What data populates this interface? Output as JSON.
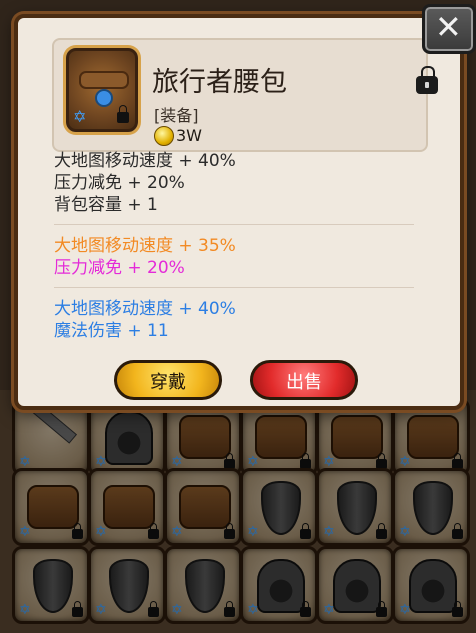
{
  "item": {
    "name": "旅行者腰包",
    "type": "[装备]",
    "price": "3W"
  },
  "stats": {
    "base": [
      "大地图移动速度 + 40%",
      "压力减免 + 20%",
      "背包容量 + 1"
    ],
    "bonus": [
      {
        "text": "大地图移动速度 + 35%",
        "color": "#f28a24"
      },
      {
        "text": "压力减免 + 20%",
        "color": "#e42ad8"
      }
    ],
    "extra": [
      {
        "text": "大地图移动速度 + 40%",
        "color": "#2c7ee3"
      },
      {
        "text": "魔法伤害 + 11",
        "color": "#2c7ee3"
      }
    ]
  },
  "buttons": {
    "equip_label": "穿戴",
    "sell_label": "出售"
  }
}
